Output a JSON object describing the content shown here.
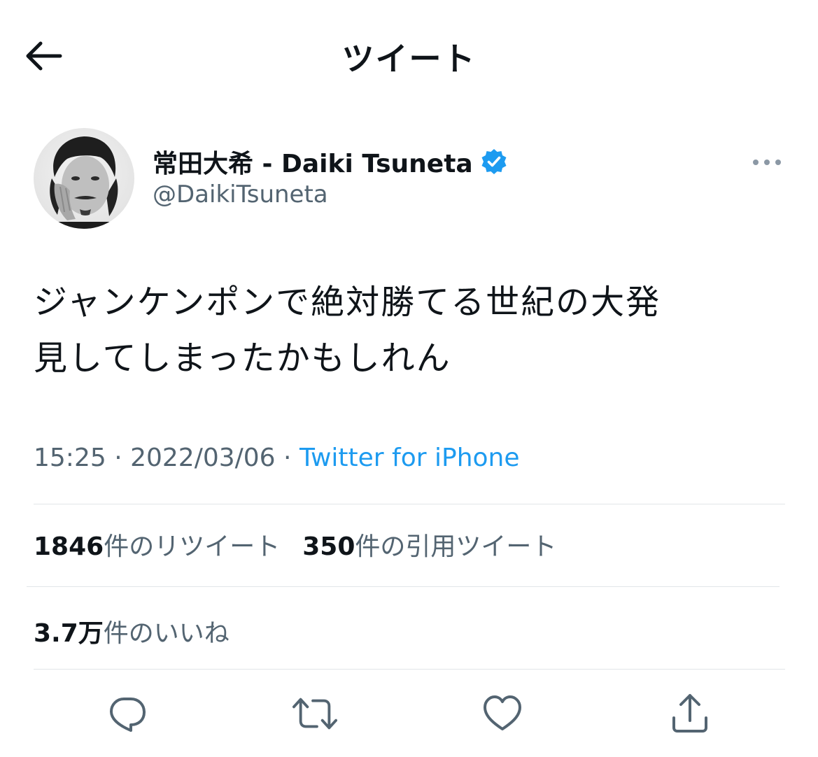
{
  "header": {
    "title": "ツイート"
  },
  "author": {
    "display_name": "常田大希 - Daiki Tsuneta",
    "handle": "@DaikiTsuneta",
    "verified": true
  },
  "tweet": {
    "text_line1": "ジャンケンポンで絶対勝てる世紀の大発",
    "text_line2": "見してしまったかもしれん"
  },
  "meta": {
    "time": "15:25",
    "separator1": " · ",
    "date": "2022/03/06",
    "separator2": " · ",
    "source": "Twitter for iPhone"
  },
  "stats": {
    "retweets_count": "1846",
    "retweets_label": "件のリツイート",
    "quotes_count": "350",
    "quotes_label": "件の引用ツイート",
    "likes_count": "3.7万",
    "likes_label": "件のいいね"
  },
  "icons": {
    "back": "arrow-left-icon",
    "more": "more-horizontal-icon",
    "verified": "verified-badge-icon",
    "reply": "reply-icon",
    "retweet": "retweet-icon",
    "like": "heart-icon",
    "share": "share-icon"
  },
  "colors": {
    "accent": "#1d9bf0",
    "secondary_text": "#536471",
    "icon_gray": "#536471",
    "divider": "#e1e5e8"
  }
}
